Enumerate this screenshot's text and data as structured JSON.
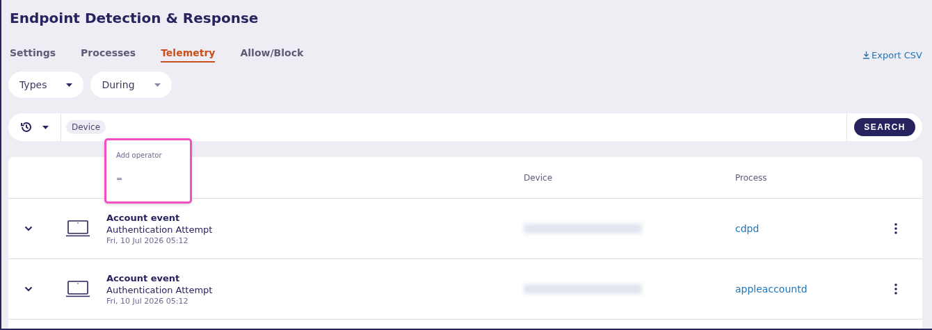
{
  "title": "Endpoint Detection & Response",
  "tabs": [
    {
      "label": "Settings",
      "selected": false
    },
    {
      "label": "Processes",
      "selected": false
    },
    {
      "label": "Telemetry",
      "selected": true
    },
    {
      "label": "Allow/Block",
      "selected": false
    }
  ],
  "export_link": "Export CSV",
  "filters": [
    {
      "label": "Types"
    },
    {
      "label": "During"
    }
  ],
  "search": {
    "chip": "Device",
    "button": "SEARCH"
  },
  "operator_menu": {
    "heading": "Add operator",
    "options": [
      "="
    ]
  },
  "table": {
    "columns": [
      "Device",
      "Process"
    ],
    "rows": [
      {
        "title": "Account event",
        "subtitle": "Authentication Attempt",
        "time": "Fri, 10 Jul 2026 05:12",
        "process": "cdpd"
      },
      {
        "title": "Account event",
        "subtitle": "Authentication Attempt",
        "time": "Fri, 10 Jul 2026 05:12",
        "process": "appleaccountd"
      }
    ]
  }
}
